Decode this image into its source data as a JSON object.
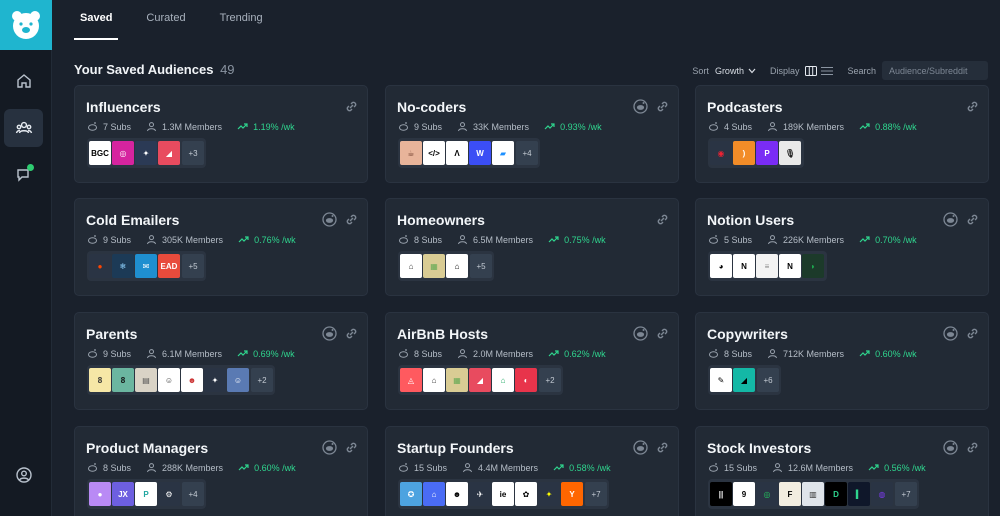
{
  "tabs": [
    {
      "label": "Saved",
      "active": true
    },
    {
      "label": "Curated",
      "active": false
    },
    {
      "label": "Trending",
      "active": false
    }
  ],
  "header": {
    "title": "Your Saved Audiences",
    "count": "49",
    "sort_label": "Sort",
    "sort_value": "Growth",
    "display_label": "Display",
    "search_label": "Search",
    "search_placeholder": "Audience/Subreddit"
  },
  "accent": "#2fd58e",
  "brand": "#1fb5cf",
  "cards": [
    {
      "title": "Influencers",
      "subs": "7 Subs",
      "members": "1.3M Members",
      "growth": "1.19% /wk",
      "more": "+3",
      "has_reddit": false,
      "icons": [
        {
          "bg": "#ffffff",
          "fg": "#000",
          "txt": "BGC"
        },
        {
          "bg": "#d6249f",
          "fg": "#fff",
          "txt": "◎"
        },
        {
          "bg": "#2b3a55",
          "fg": "#fff",
          "txt": "✦"
        },
        {
          "bg": "#e84b5f",
          "fg": "#fff",
          "txt": "◢"
        }
      ]
    },
    {
      "title": "No-coders",
      "subs": "9 Subs",
      "members": "33K Members",
      "growth": "0.93% /wk",
      "more": "+4",
      "has_reddit": true,
      "icons": [
        {
          "bg": "#e8b49a",
          "fg": "#6a3a2a",
          "txt": "☕"
        },
        {
          "bg": "#ffffff",
          "fg": "#000",
          "txt": "</>"
        },
        {
          "bg": "#ffffff",
          "fg": "#000",
          "txt": "Λ"
        },
        {
          "bg": "#3b4ef5",
          "fg": "#fff",
          "txt": "W"
        },
        {
          "bg": "#ffffff",
          "fg": "#1e90ff",
          "txt": "▰"
        }
      ]
    },
    {
      "title": "Podcasters",
      "subs": "4 Subs",
      "members": "189K Members",
      "growth": "0.88% /wk",
      "more": "",
      "has_reddit": false,
      "icons": [
        {
          "bg": "#2a3444",
          "fg": "#e23",
          "txt": "◉"
        },
        {
          "bg": "#f28c28",
          "fg": "#fff",
          "txt": ")"
        },
        {
          "bg": "#7a2cf5",
          "fg": "#fff",
          "txt": "P"
        },
        {
          "bg": "#e9e9e9",
          "fg": "#222",
          "txt": "🎙"
        }
      ]
    },
    {
      "title": "Cold Emailers",
      "subs": "9 Subs",
      "members": "305K Members",
      "growth": "0.76% /wk",
      "more": "+5",
      "has_reddit": true,
      "icons": [
        {
          "bg": "#2a3444",
          "fg": "#ff4500",
          "txt": "●"
        },
        {
          "bg": "#1c3a56",
          "fg": "#8fd3ff",
          "txt": "❄"
        },
        {
          "bg": "#1f8fd0",
          "fg": "#fff",
          "txt": "✉"
        },
        {
          "bg": "#e84b3c",
          "fg": "#fff",
          "txt": "EAD"
        }
      ]
    },
    {
      "title": "Homeowners",
      "subs": "8 Subs",
      "members": "6.5M Members",
      "growth": "0.75% /wk",
      "more": "+5",
      "has_reddit": false,
      "icons": [
        {
          "bg": "#ffffff",
          "fg": "#333",
          "txt": "⌂"
        },
        {
          "bg": "#d9cc94",
          "fg": "#6a5",
          "txt": "▦"
        },
        {
          "bg": "#ffffff",
          "fg": "#000",
          "txt": "⌂"
        }
      ]
    },
    {
      "title": "Notion Users",
      "subs": "5 Subs",
      "members": "226K Members",
      "growth": "0.70% /wk",
      "more": "",
      "has_reddit": true,
      "icons": [
        {
          "bg": "#ffffff",
          "fg": "#000",
          "txt": "◕"
        },
        {
          "bg": "#ffffff",
          "fg": "#000",
          "txt": "N"
        },
        {
          "bg": "#f3f3f3",
          "fg": "#888",
          "txt": "≡"
        },
        {
          "bg": "#ffffff",
          "fg": "#000",
          "txt": "N"
        },
        {
          "bg": "#1c3a2a",
          "fg": "#1db954",
          "txt": "◗"
        }
      ]
    },
    {
      "title": "Parents",
      "subs": "9 Subs",
      "members": "6.1M Members",
      "growth": "0.69% /wk",
      "more": "+2",
      "has_reddit": true,
      "icons": [
        {
          "bg": "#f6e7a6",
          "fg": "#333",
          "txt": "8"
        },
        {
          "bg": "#6bb6a0",
          "fg": "#111",
          "txt": "8"
        },
        {
          "bg": "#d9d3c6",
          "fg": "#555",
          "txt": "▤"
        },
        {
          "bg": "#ffffff",
          "fg": "#333",
          "txt": "☺"
        },
        {
          "bg": "#ffffff",
          "fg": "#c33",
          "txt": "☻"
        },
        {
          "bg": "#2a3444",
          "fg": "#fff",
          "txt": "✦"
        },
        {
          "bg": "#5a7ab3",
          "fg": "#fff",
          "txt": "☺"
        }
      ]
    },
    {
      "title": "AirBnB Hosts",
      "subs": "8 Subs",
      "members": "2.0M Members",
      "growth": "0.62% /wk",
      "more": "+2",
      "has_reddit": true,
      "icons": [
        {
          "bg": "#ff5a5f",
          "fg": "#fff",
          "txt": "◬"
        },
        {
          "bg": "#ffffff",
          "fg": "#333",
          "txt": "⌂"
        },
        {
          "bg": "#d9cc94",
          "fg": "#6a5",
          "txt": "▦"
        },
        {
          "bg": "#e84b5f",
          "fg": "#fff",
          "txt": "◢"
        },
        {
          "bg": "#ffffff",
          "fg": "#2a6",
          "txt": "⌂"
        },
        {
          "bg": "#e8344b",
          "fg": "#fff",
          "txt": "◐"
        }
      ]
    },
    {
      "title": "Copywriters",
      "subs": "8 Subs",
      "members": "712K Members",
      "growth": "0.60% /wk",
      "more": "+6",
      "has_reddit": true,
      "icons": [
        {
          "bg": "#ffffff",
          "fg": "#000",
          "txt": "✎"
        },
        {
          "bg": "#14b8a6",
          "fg": "#000",
          "txt": "◢"
        }
      ]
    },
    {
      "title": "Product Managers",
      "subs": "8 Subs",
      "members": "288K Members",
      "growth": "0.60% /wk",
      "more": "+4",
      "has_reddit": true,
      "icons": [
        {
          "bg": "#b98af5",
          "fg": "#fff",
          "txt": "●"
        },
        {
          "bg": "#6d5fe0",
          "fg": "#fff",
          "txt": "JX"
        },
        {
          "bg": "#ffffff",
          "fg": "#20a6a0",
          "txt": "P"
        },
        {
          "bg": "#2a3444",
          "fg": "#fff",
          "txt": "⚙"
        }
      ]
    },
    {
      "title": "Startup Founders",
      "subs": "15 Subs",
      "members": "4.4M Members",
      "growth": "0.58% /wk",
      "more": "+7",
      "has_reddit": true,
      "icons": [
        {
          "bg": "#4da3e0",
          "fg": "#fff",
          "txt": "✪"
        },
        {
          "bg": "#4a6cf5",
          "fg": "#fff",
          "txt": "⌂"
        },
        {
          "bg": "#ffffff",
          "fg": "#000",
          "txt": "☻"
        },
        {
          "bg": "#2a3444",
          "fg": "#fff",
          "txt": "✈"
        },
        {
          "bg": "#ffffff",
          "fg": "#000",
          "txt": "ie"
        },
        {
          "bg": "#ffffff",
          "fg": "#000",
          "txt": "✿"
        },
        {
          "bg": "#2a3444",
          "fg": "#ff0",
          "txt": "✦"
        },
        {
          "bg": "#ff6600",
          "fg": "#fff",
          "txt": "Y"
        }
      ]
    },
    {
      "title": "Stock Investors",
      "subs": "15 Subs",
      "members": "12.6M Members",
      "growth": "0.56% /wk",
      "more": "+7",
      "has_reddit": true,
      "icons": [
        {
          "bg": "#000000",
          "fg": "#fff",
          "txt": "||"
        },
        {
          "bg": "#ffffff",
          "fg": "#000",
          "txt": "9"
        },
        {
          "bg": "#2a3444",
          "fg": "#22c55e",
          "txt": "◎"
        },
        {
          "bg": "#f2ede0",
          "fg": "#000",
          "txt": "F"
        },
        {
          "bg": "#dfe4ea",
          "fg": "#333",
          "txt": "▥"
        },
        {
          "bg": "#000000",
          "fg": "#2fd58e",
          "txt": "D"
        },
        {
          "bg": "#0f172a",
          "fg": "#2fd58e",
          "txt": "▍"
        },
        {
          "bg": "#2a3444",
          "fg": "#7c3aed",
          "txt": "◍"
        }
      ]
    }
  ]
}
